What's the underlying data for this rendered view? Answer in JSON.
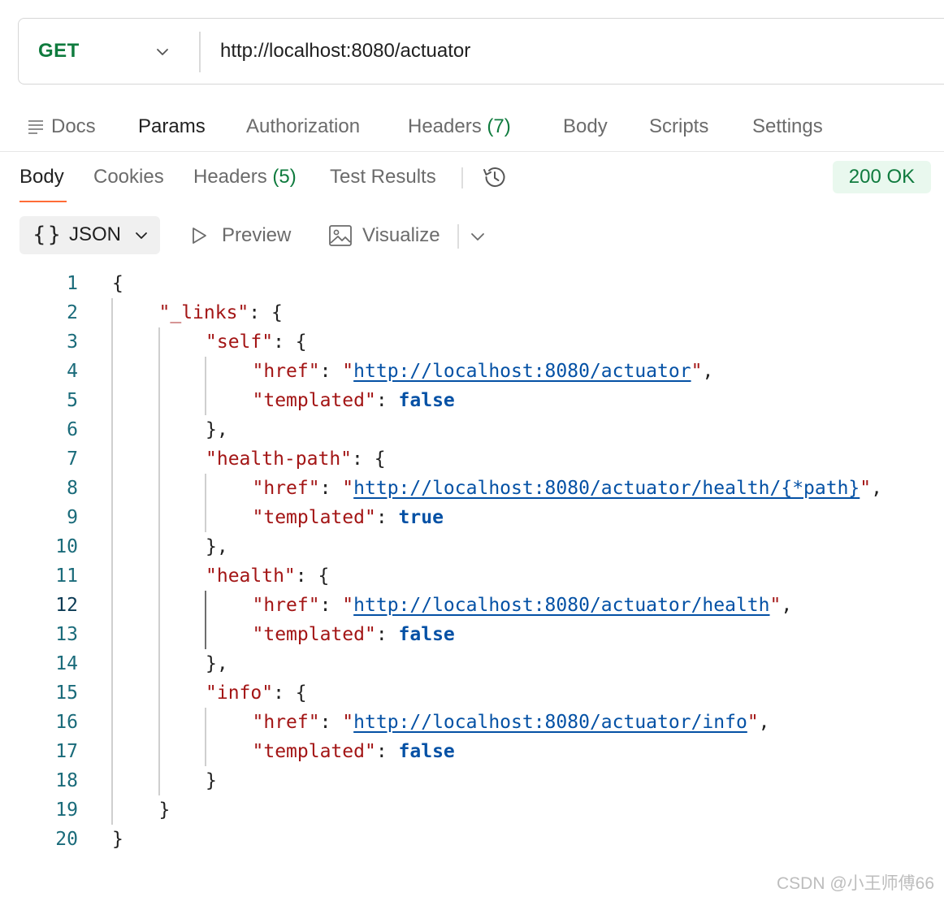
{
  "request": {
    "method": "GET",
    "url": "http://localhost:8080/actuator"
  },
  "request_tabs": {
    "docs": "Docs",
    "params": "Params",
    "authorization": "Authorization",
    "headers": "Headers",
    "headers_count": "(7)",
    "body": "Body",
    "scripts": "Scripts",
    "settings": "Settings"
  },
  "response_tabs": {
    "body": "Body",
    "cookies": "Cookies",
    "headers": "Headers",
    "headers_count": "(5)",
    "test_results": "Test Results",
    "status": "200 OK"
  },
  "view_toolbar": {
    "format": "JSON",
    "preview": "Preview",
    "visualize": "Visualize"
  },
  "code": {
    "current_line": 12,
    "lines": [
      {
        "n": "1",
        "indent": 0,
        "parts": [
          [
            "p",
            "{"
          ]
        ]
      },
      {
        "n": "2",
        "indent": 1,
        "parts": [
          [
            "k",
            "\"_links\""
          ],
          [
            "p",
            ": {"
          ]
        ]
      },
      {
        "n": "3",
        "indent": 2,
        "parts": [
          [
            "k",
            "\"self\""
          ],
          [
            "p",
            ": {"
          ]
        ]
      },
      {
        "n": "4",
        "indent": 3,
        "parts": [
          [
            "k",
            "\"href\""
          ],
          [
            "p",
            ": "
          ],
          [
            "q",
            "\""
          ],
          [
            "s",
            "http://localhost:8080/actuator"
          ],
          [
            "q",
            "\""
          ],
          [
            "p",
            ","
          ]
        ]
      },
      {
        "n": "5",
        "indent": 3,
        "parts": [
          [
            "k",
            "\"templated\""
          ],
          [
            "p",
            ": "
          ],
          [
            "b",
            "false"
          ]
        ]
      },
      {
        "n": "6",
        "indent": 2,
        "parts": [
          [
            "p",
            "},"
          ]
        ]
      },
      {
        "n": "7",
        "indent": 2,
        "parts": [
          [
            "k",
            "\"health-path\""
          ],
          [
            "p",
            ": {"
          ]
        ]
      },
      {
        "n": "8",
        "indent": 3,
        "parts": [
          [
            "k",
            "\"href\""
          ],
          [
            "p",
            ": "
          ],
          [
            "q",
            "\""
          ],
          [
            "s",
            "http://localhost:8080/actuator/health/{*path}"
          ],
          [
            "q",
            "\""
          ],
          [
            "p",
            ","
          ]
        ]
      },
      {
        "n": "9",
        "indent": 3,
        "parts": [
          [
            "k",
            "\"templated\""
          ],
          [
            "p",
            ": "
          ],
          [
            "b",
            "true"
          ]
        ]
      },
      {
        "n": "10",
        "indent": 2,
        "parts": [
          [
            "p",
            "},"
          ]
        ]
      },
      {
        "n": "11",
        "indent": 2,
        "parts": [
          [
            "k",
            "\"health\""
          ],
          [
            "p",
            ": {"
          ]
        ]
      },
      {
        "n": "12",
        "indent": 3,
        "parts": [
          [
            "k",
            "\"href\""
          ],
          [
            "p",
            ": "
          ],
          [
            "q",
            "\""
          ],
          [
            "s",
            "http://localhost:8080/actuator/health"
          ],
          [
            "q",
            "\""
          ],
          [
            "p",
            ","
          ]
        ]
      },
      {
        "n": "13",
        "indent": 3,
        "parts": [
          [
            "k",
            "\"templated\""
          ],
          [
            "p",
            ": "
          ],
          [
            "b",
            "false"
          ]
        ]
      },
      {
        "n": "14",
        "indent": 2,
        "parts": [
          [
            "p",
            "},"
          ]
        ]
      },
      {
        "n": "15",
        "indent": 2,
        "parts": [
          [
            "k",
            "\"info\""
          ],
          [
            "p",
            ": {"
          ]
        ]
      },
      {
        "n": "16",
        "indent": 3,
        "parts": [
          [
            "k",
            "\"href\""
          ],
          [
            "p",
            ": "
          ],
          [
            "q",
            "\""
          ],
          [
            "s",
            "http://localhost:8080/actuator/info"
          ],
          [
            "q",
            "\""
          ],
          [
            "p",
            ","
          ]
        ]
      },
      {
        "n": "17",
        "indent": 3,
        "parts": [
          [
            "k",
            "\"templated\""
          ],
          [
            "p",
            ": "
          ],
          [
            "b",
            "false"
          ]
        ]
      },
      {
        "n": "18",
        "indent": 2,
        "parts": [
          [
            "p",
            "}"
          ]
        ]
      },
      {
        "n": "19",
        "indent": 1,
        "parts": [
          [
            "p",
            "}"
          ]
        ]
      },
      {
        "n": "20",
        "indent": 0,
        "parts": [
          [
            "p",
            "}"
          ]
        ]
      }
    ]
  },
  "watermark": "CSDN @小王师傅66"
}
